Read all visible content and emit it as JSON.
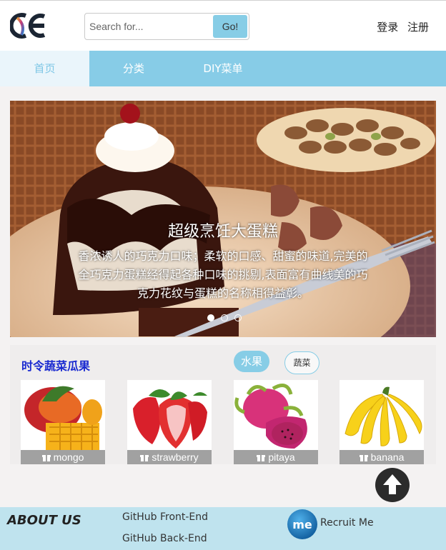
{
  "header": {
    "search_placeholder": "Search for...",
    "go_label": "Go!",
    "login": "登录",
    "register": "注册"
  },
  "nav": {
    "tabs": [
      "首页",
      "分类",
      "DIY菜单"
    ]
  },
  "banner": {
    "title": "超级烹饪大蛋糕",
    "description": "香浓诱人的巧克力口味；柔软的口感、甜蜜的味道,完美的全巧克力蛋糕经得起各种口味的挑剔,表面富有曲线美的巧克力花纹与蛋糕的名称相得益彰。",
    "active_slide": 1,
    "slide_count": 3
  },
  "fruits": {
    "heading": "时令蔬菜瓜果",
    "filter_fruit": "水果",
    "filter_veg": "蔬菜",
    "items": [
      {
        "name": "mongo",
        "icon": "mango-image"
      },
      {
        "name": "strawberry",
        "icon": "strawberry-image"
      },
      {
        "name": "pitaya",
        "icon": "pitaya-image"
      },
      {
        "name": "banana",
        "icon": "banana-image"
      }
    ]
  },
  "footer": {
    "about": "ABOUT US",
    "link_frontend": "GitHub Front-End",
    "link_backend": "GitHub Back-End",
    "recruit": "Recruit Me",
    "me_badge": "me"
  },
  "colors": {
    "accent": "#87cce7",
    "heading_blue": "#1a2ad0",
    "footer_bg": "#bfe3ee"
  },
  "icons": [
    "logo-icon",
    "gift-icon",
    "arrow-up-icon",
    "me-icon"
  ]
}
